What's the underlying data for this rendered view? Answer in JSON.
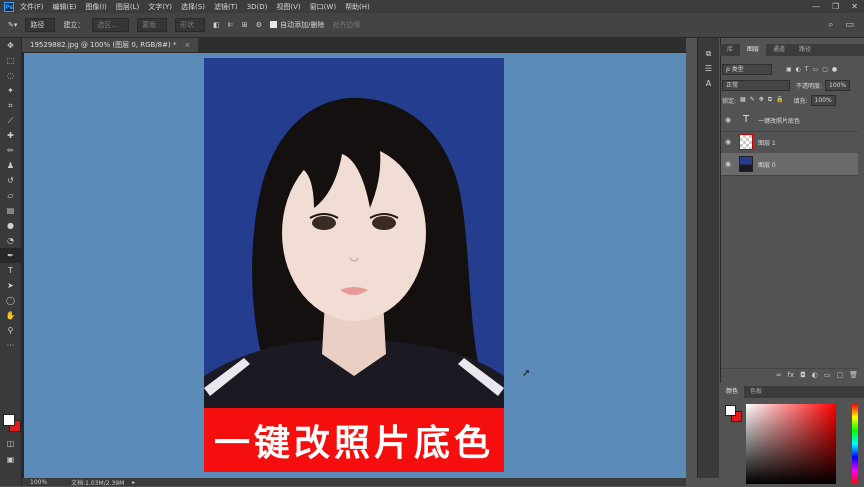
{
  "menu": {
    "logo": "Ps",
    "items": [
      "文件(F)",
      "编辑(E)",
      "图像(I)",
      "图层(L)",
      "文字(Y)",
      "选择(S)",
      "滤镜(T)",
      "3D(D)",
      "视图(V)",
      "窗口(W)",
      "帮助(H)"
    ],
    "window_controls": [
      "—",
      "❐",
      "✕"
    ]
  },
  "options": {
    "mode": "路径",
    "build_label": "建立：",
    "selection_btn": "选区...",
    "mask_btn": "蒙版",
    "shape_btn": "形状",
    "auto_add_delete": "自动添加/删除",
    "align_edges": "对齐边缘"
  },
  "document": {
    "tab_title": "19529882.jpg @ 100% (图层 0, RGB/8#) *",
    "close": "×",
    "banner_text": "一键改照片底色",
    "zoom": "100%",
    "doc_info": "文档:1.03M/2.39M",
    "arrow": "▸"
  },
  "layers_panel": {
    "tabs": [
      "库",
      "图层",
      "通道",
      "路径"
    ],
    "active_tab": "图层",
    "filter_label": "ρ 类型",
    "blend_mode": "正常",
    "opacity_label": "不透明度:",
    "opacity_value": "100%",
    "lock_label": "锁定:",
    "fill_label": "填充:",
    "fill_value": "100%",
    "layers": [
      {
        "name": "一键改照片底色",
        "type": "text",
        "thumb": "T"
      },
      {
        "name": "图层 1",
        "type": "transparent"
      },
      {
        "name": "图层 0",
        "type": "photo",
        "selected": true
      }
    ],
    "bottom_icons": [
      "∞",
      "fx",
      "◘",
      "◐",
      "▭",
      "▢",
      "🗑"
    ]
  },
  "color_panel": {
    "tabs": [
      "颜色",
      "色板"
    ],
    "active_tab": "颜色"
  },
  "colors": {
    "canvas_bg": "#5a8bb9",
    "photo_bg": "#253d8e",
    "banner": "#f50e0e"
  }
}
